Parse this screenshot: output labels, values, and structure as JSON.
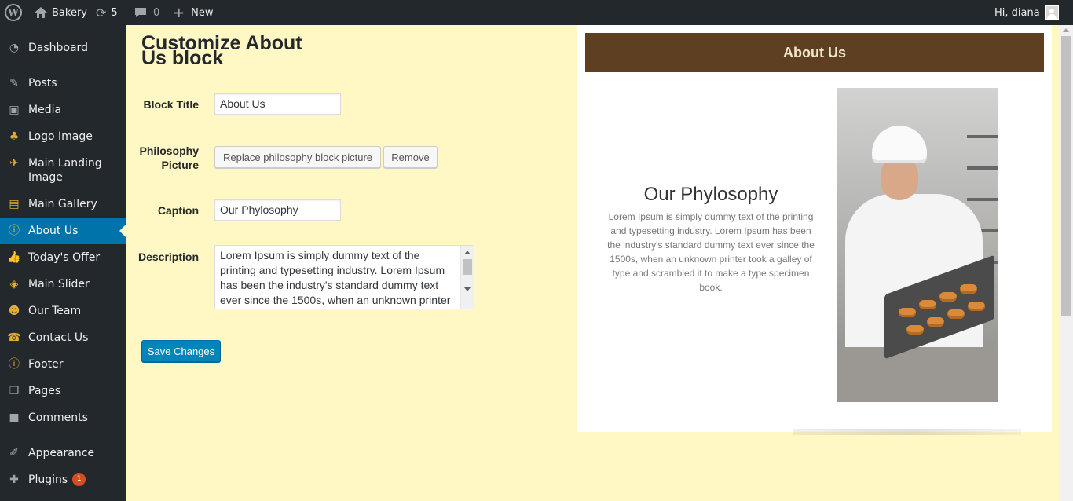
{
  "admin_bar": {
    "site_name": "Bakery",
    "updates_count": "5",
    "comments_count": "0",
    "new_label": "New",
    "greeting": "Hi, diana"
  },
  "sidebar": {
    "items": [
      {
        "label": "Dashboard",
        "icon": "dashboard-icon"
      },
      {
        "label": "Posts",
        "icon": "pin-icon"
      },
      {
        "label": "Media",
        "icon": "media-icon"
      },
      {
        "label": "Logo Image",
        "icon": "cupcake-icon"
      },
      {
        "label": "Main Landing Image",
        "icon": "plane-icon"
      },
      {
        "label": "Main Gallery",
        "icon": "gallery-icon"
      },
      {
        "label": "About Us",
        "icon": "info-icon"
      },
      {
        "label": "Today's Offer",
        "icon": "thumbs-up-icon"
      },
      {
        "label": "Main Slider",
        "icon": "layers-icon"
      },
      {
        "label": "Our Team",
        "icon": "groups-icon"
      },
      {
        "label": "Contact Us",
        "icon": "phone-icon"
      },
      {
        "label": "Footer",
        "icon": "info-icon"
      },
      {
        "label": "Pages",
        "icon": "pages-icon"
      },
      {
        "label": "Comments",
        "icon": "comment-icon"
      },
      {
        "label": "Appearance",
        "icon": "brush-icon"
      },
      {
        "label": "Plugins",
        "icon": "plugin-icon",
        "badge": "1"
      }
    ]
  },
  "editor": {
    "title": "Customize About Us block",
    "block_title_label": "Block Title",
    "block_title_value": "About Us",
    "picture_label": "Philosophy Picture",
    "replace_button": "Replace philosophy block picture",
    "remove_button": "Remove",
    "caption_label": "Caption",
    "caption_value": "Our Phylosophy",
    "description_label": "Description",
    "description_value": "Lorem Ipsum is simply dummy text of the printing and typesetting industry. Lorem Ipsum has been the industry's standard dummy text ever since the 1500s, when an unknown printer took a galley of type and scrambled it to make a type specimen book.",
    "save_button": "Save Changes"
  },
  "preview": {
    "header": "About Us",
    "caption": "Our Phylosophy",
    "text": "Lorem Ipsum is simply dummy text of the printing and typesetting industry. Lorem Ipsum has been the industry's standard dummy text ever since the 1500s, when an unknown printer took a galley of type and scrambled it to make a type specimen book.",
    "header_color": "#5e3f22"
  },
  "colors": {
    "admin_bg": "#23282d",
    "active_menu": "#0073aa",
    "page_bg": "#fff8c4",
    "primary_button": "#0085ba"
  }
}
